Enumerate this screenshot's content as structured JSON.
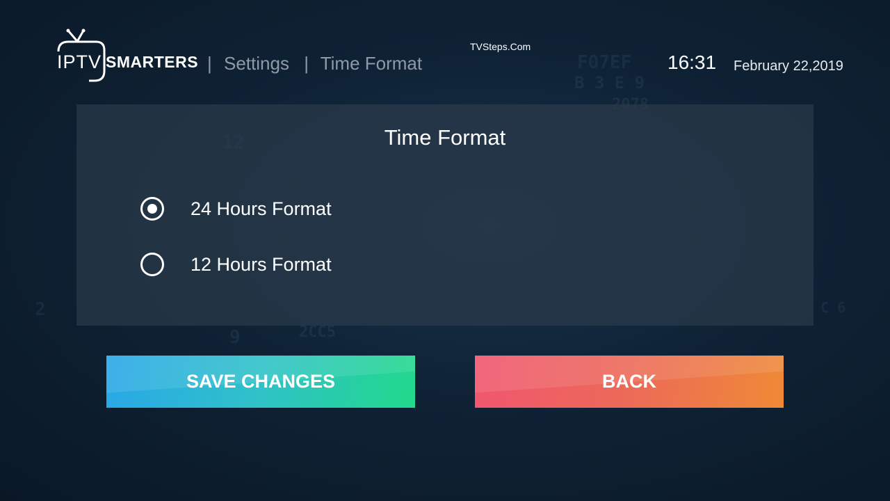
{
  "header": {
    "logo": {
      "iptv": "IPTV",
      "smarters": "SMARTERS"
    },
    "breadcrumb": {
      "separator": "|",
      "settings": "Settings",
      "current": "Time Format"
    },
    "watermark": "TVSteps.Com",
    "clock": "16:31",
    "date": "February 22,2019"
  },
  "panel": {
    "title": "Time Format",
    "options": [
      {
        "label": "24 Hours Format",
        "selected": true
      },
      {
        "label": "12 Hours Format",
        "selected": false
      }
    ]
  },
  "buttons": {
    "save_label": "SAVE CHANGES",
    "back_label": "BACK"
  },
  "colors": {
    "save_gradient": [
      "#29a7e8",
      "#22d98b"
    ],
    "back_gradient": [
      "#f0566f",
      "#ef8a36"
    ],
    "panel_bg": "#2a3a4a"
  }
}
